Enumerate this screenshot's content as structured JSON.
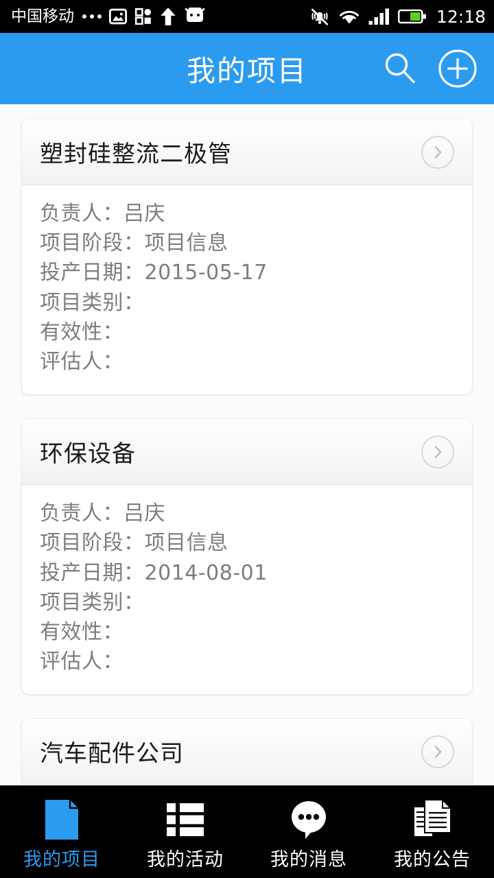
{
  "status_bar": {
    "carrier": "中国移动",
    "time": "12:18",
    "icons": [
      "more-dots-icon",
      "image-icon",
      "apps-icon",
      "upload-arrow-icon",
      "android-robot-icon",
      "silent-bell-icon",
      "wifi-icon",
      "signal-icon",
      "battery-icon"
    ],
    "battery_color": "#5fd020"
  },
  "header": {
    "title": "我的项目",
    "background": "#2b9bf0",
    "search_label": "search-icon",
    "add_label": "add-circle-icon"
  },
  "list": {
    "labels": {
      "owner": "负责人：",
      "stage": "项目阶段：",
      "launch_date": "投产日期：",
      "category": "项目类别：",
      "validity": "有效性：",
      "assessor": "评估人："
    },
    "cards": [
      {
        "title": "塑封硅整流二极管",
        "rows": [
          "负责人：吕庆",
          "项目阶段：项目信息",
          "投产日期：2015-05-17",
          "项目类别：",
          "有效性：",
          "评估人："
        ]
      },
      {
        "title": "环保设备",
        "rows": [
          "负责人：吕庆",
          "项目阶段：项目信息",
          "投产日期：2014-08-01",
          "项目类别：",
          "有效性：",
          "评估人："
        ]
      },
      {
        "title": "汽车配件公司",
        "rows": []
      }
    ]
  },
  "bottom_nav": {
    "active_color": "#2b9bf0",
    "items": [
      {
        "label": "我的项目",
        "icon": "document-icon",
        "active": true
      },
      {
        "label": "我的活动",
        "icon": "list-icon",
        "active": false
      },
      {
        "label": "我的消息",
        "icon": "chat-bubble-icon",
        "active": false
      },
      {
        "label": "我的公告",
        "icon": "documents-stack-icon",
        "active": false
      }
    ]
  }
}
